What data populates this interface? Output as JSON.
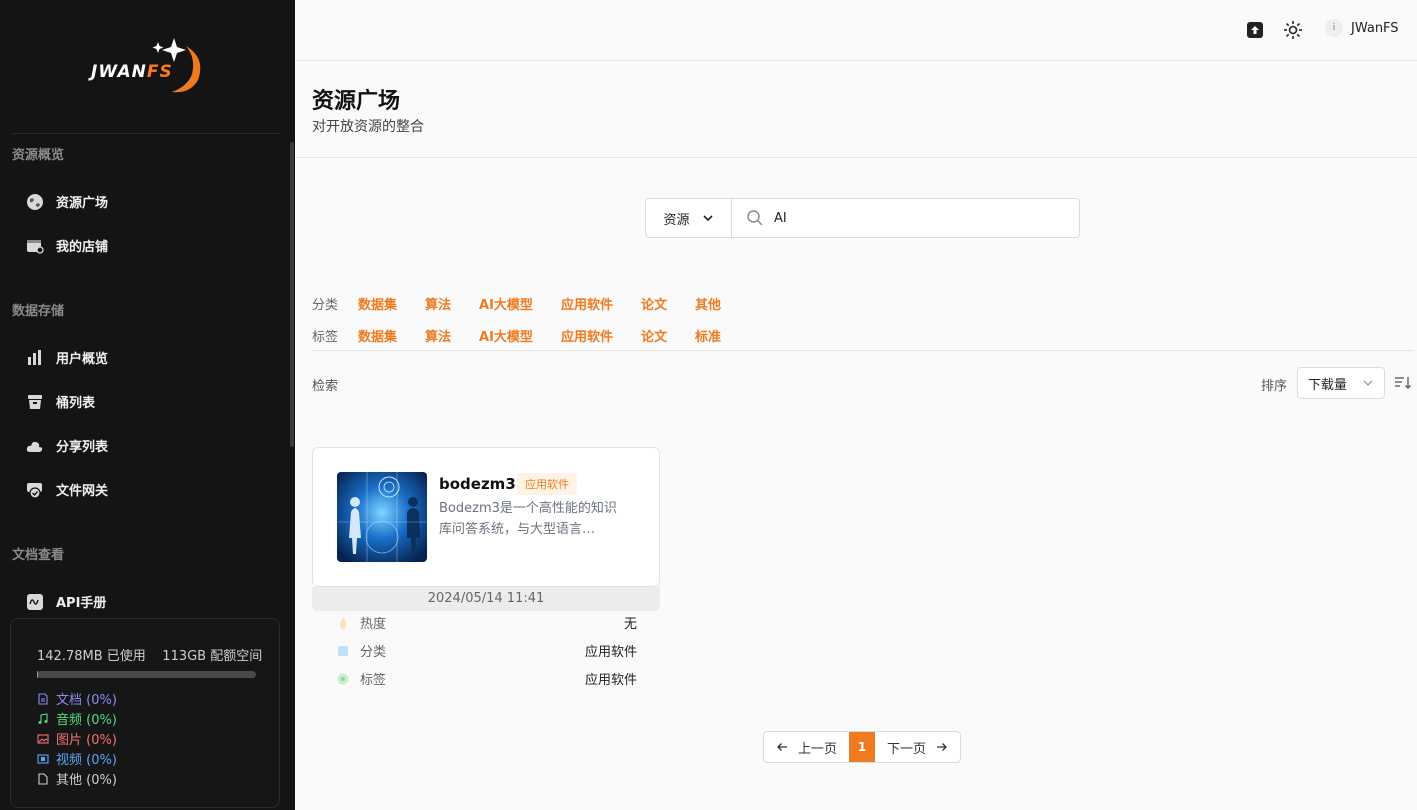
{
  "brand": {
    "logo_main": "JWAN",
    "logo_accent": "FS",
    "accent_color": "#f07a1f"
  },
  "sidebar": {
    "sections": [
      {
        "title": "资源概览",
        "items": [
          {
            "label": "资源广场",
            "icon": "globe-icon"
          },
          {
            "label": "我的店铺",
            "icon": "store-icon"
          }
        ]
      },
      {
        "title": "数据存储",
        "items": [
          {
            "label": "用户概览",
            "icon": "bar-chart-icon"
          },
          {
            "label": "桶列表",
            "icon": "bucket-icon"
          },
          {
            "label": "分享列表",
            "icon": "cloud-icon"
          },
          {
            "label": "文件网关",
            "icon": "shield-icon"
          }
        ]
      },
      {
        "title": "文档查看",
        "items": [
          {
            "label": "API手册",
            "icon": "api-icon"
          }
        ]
      }
    ],
    "storage": {
      "used": "142.78MB 已使用",
      "quota": "113GB 配额空间",
      "usage_fraction": 0.0013,
      "legend": [
        {
          "label": "文档 (0%)",
          "color": "#8b8bf5",
          "icon": "document-icon"
        },
        {
          "label": "音频 (0%)",
          "color": "#4ade80",
          "icon": "music-icon"
        },
        {
          "label": "图片 (0%)",
          "color": "#f87171",
          "icon": "image-icon"
        },
        {
          "label": "视频 (0%)",
          "color": "#60a5fa",
          "icon": "video-icon"
        },
        {
          "label": "其他 (0%)",
          "color": "#cfcfcf",
          "icon": "file-icon"
        }
      ]
    }
  },
  "topbar": {
    "user_initial": "i",
    "user_name": "JWanFS",
    "icons": [
      "upload-icon",
      "sun-icon"
    ]
  },
  "header": {
    "title": "资源广场",
    "subtitle": "对开放资源的整合"
  },
  "search": {
    "type_selected": "资源",
    "query": "AI"
  },
  "filters": {
    "category_label": "分类",
    "categories": [
      "数据集",
      "算法",
      "AI大模型",
      "应用软件",
      "论文",
      "其他"
    ],
    "tag_label": "标签",
    "tags": [
      "数据集",
      "算法",
      "AI大模型",
      "应用软件",
      "论文",
      "标准"
    ]
  },
  "results": {
    "label": "检索",
    "sort_label": "排序",
    "sort_selected": "下载量"
  },
  "card": {
    "name": "bodezm3",
    "tag": "应用软件",
    "description": "Bodezm3是一个高性能的知识库问答系统，与大型语言…",
    "date": "2024/05/14 11:41",
    "meta": [
      {
        "label": "热度",
        "value": "无",
        "color": "#fde5b8"
      },
      {
        "label": "分类",
        "value": "应用软件",
        "color": "#bfe0fb"
      },
      {
        "label": "标签",
        "value": "应用软件",
        "color": "#c6f0cf"
      }
    ]
  },
  "pagination": {
    "prev": "上一页",
    "current": "1",
    "next": "下一页"
  }
}
